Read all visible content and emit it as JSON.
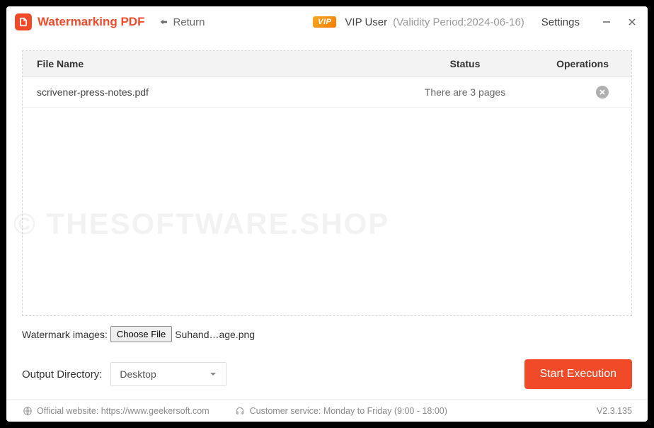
{
  "titlebar": {
    "app_title": "Watermarking PDF",
    "return_label": "Return",
    "vip_badge": "VIP",
    "vip_user": "VIP User",
    "validity": "(Validity Period:2024-06-16)",
    "settings_label": "Settings"
  },
  "table": {
    "headers": {
      "filename": "File Name",
      "status": "Status",
      "operations": "Operations"
    },
    "rows": [
      {
        "filename": "scrivener-press-notes.pdf",
        "status": "There are 3 pages"
      }
    ]
  },
  "watermark": {
    "label": "Watermark images:",
    "choose_button": "Choose File",
    "chosen_file": "Suhand…age.png"
  },
  "output": {
    "label": "Output Directory:",
    "selected": "Desktop"
  },
  "actions": {
    "start_button": "Start Execution"
  },
  "footer": {
    "website_label": "Official website: https://www.geekersoft.com",
    "service_label": "Customer service: Monday to Friday (9:00 - 18:00)",
    "version": "V2.3.135"
  },
  "overlay_text": "© THESOFTWARE.SHOP"
}
